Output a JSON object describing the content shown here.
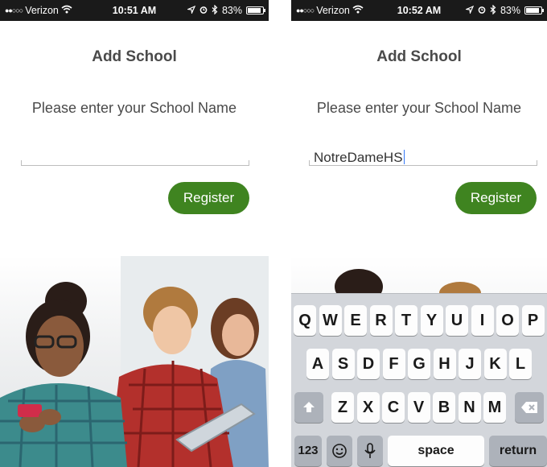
{
  "colors": {
    "accent": "#3f8420",
    "status_bar": "#1a1a1a",
    "keyboard_bg": "#d3d6db"
  },
  "left_screen": {
    "status": {
      "carrier": "Verizon",
      "time": "10:51 AM",
      "battery": "83%"
    },
    "title": "Add School",
    "prompt": "Please enter your School Name",
    "school_input": {
      "value": "",
      "placeholder": ""
    },
    "register_label": "Register"
  },
  "right_screen": {
    "status": {
      "carrier": "Verizon",
      "time": "10:52 AM",
      "battery": "83%"
    },
    "title": "Add School",
    "prompt": "Please enter your School Name",
    "school_input": {
      "value": "NotreDameHS",
      "placeholder": ""
    },
    "register_label": "Register",
    "keyboard": {
      "row1": [
        "Q",
        "W",
        "E",
        "R",
        "T",
        "Y",
        "U",
        "I",
        "O",
        "P"
      ],
      "row2": [
        "A",
        "S",
        "D",
        "F",
        "G",
        "H",
        "J",
        "K",
        "L"
      ],
      "row3": [
        "Z",
        "X",
        "C",
        "V",
        "B",
        "N",
        "M"
      ],
      "numbers_label": "123",
      "space_label": "space",
      "return_label": "return"
    }
  },
  "battery_level": 0.83,
  "icons": [
    "signal-dots-icon",
    "wifi-icon",
    "location-icon",
    "alarm-icon",
    "bluetooth-icon",
    "battery-icon",
    "shift-icon",
    "backspace-icon",
    "emoji-icon",
    "microphone-icon"
  ]
}
